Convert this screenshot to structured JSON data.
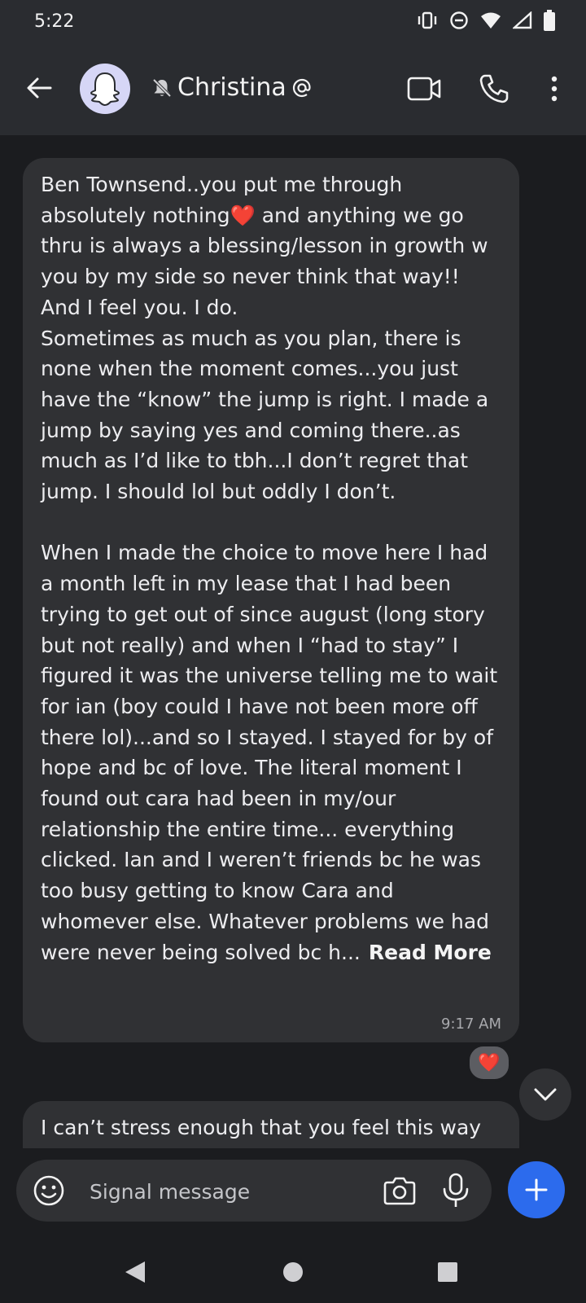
{
  "status_bar": {
    "time": "5:22",
    "icons": [
      "vibrate-icon",
      "do-not-disturb-icon",
      "wifi-icon",
      "signal-icon",
      "battery-icon"
    ]
  },
  "header": {
    "contact_name": "Christina",
    "muted": true,
    "icons": [
      "back-arrow-icon",
      "ghost-avatar-icon",
      "bell-muted-icon",
      "at-sign-icon",
      "video-call-icon",
      "phone-call-icon",
      "more-options-icon"
    ]
  },
  "messages": [
    {
      "text_part1": "Ben Townsend..you put me through absolutely nothing",
      "emoji": "❤️",
      "text_part2": " and anything we go thru is always a blessing/lesson in growth w you by my side so never think that way!!\nAnd I feel you. I do.\nSometimes as much as you plan, there is none when the moment comes...you just have the “know” the jump is right. I made a jump by saying yes and coming there..as much as I’d like to tbh...I don’t regret that jump. I should lol but oddly I don’t.\n\nWhen I made the choice to move here I had a month left in my lease that I had been trying to get out of since august (long story but not really) and when I “had to stay” I figured it was the universe telling me to wait for ian (boy could I have not been more off there lol)...and so I stayed. I stayed for by of hope and bc of love. The literal moment I found out cara had been in my/our relationship the entire time... everything clicked. Ian and I weren’t friends bc he was too busy getting to know Cara and whomever else. Whatever problems we had were never being solved bc h...",
      "read_more": "Read More",
      "time": "9:17 AM",
      "reaction": "❤️"
    },
    {
      "text": "I can’t stress enough that you feel this way"
    }
  ],
  "composer": {
    "placeholder": "Signal message"
  },
  "colors": {
    "background": "#1b1c1f",
    "header": "#2a2c30",
    "bubble": "#303134",
    "accent": "#2c6bed",
    "heart": "#e3242b"
  }
}
